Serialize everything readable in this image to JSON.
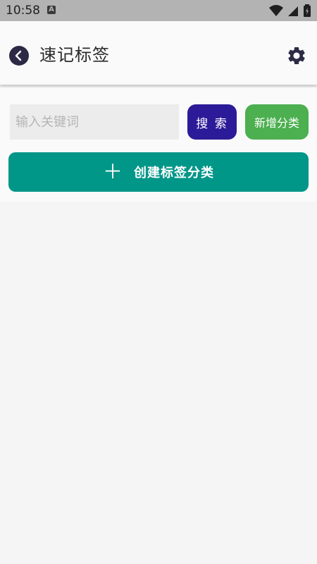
{
  "status_bar": {
    "time": "10:58",
    "app_icon_letter": "A",
    "icons": [
      "wifi-icon",
      "signal-icon",
      "battery-icon"
    ]
  },
  "app_bar": {
    "title": "速记标签",
    "back_icon": "chevron-left-icon",
    "settings_icon": "gear-icon"
  },
  "search": {
    "placeholder": "输入关键词",
    "value": "",
    "search_label": "搜 索",
    "add_category_label": "新增分类"
  },
  "create": {
    "icon": "plus-icon",
    "plus_symbol": "＋",
    "label": "创建标签分类"
  },
  "colors": {
    "search_button": "#2c1b98",
    "add_button": "#4caf50",
    "create_button": "#009688",
    "back_button": "#2d2a45"
  }
}
